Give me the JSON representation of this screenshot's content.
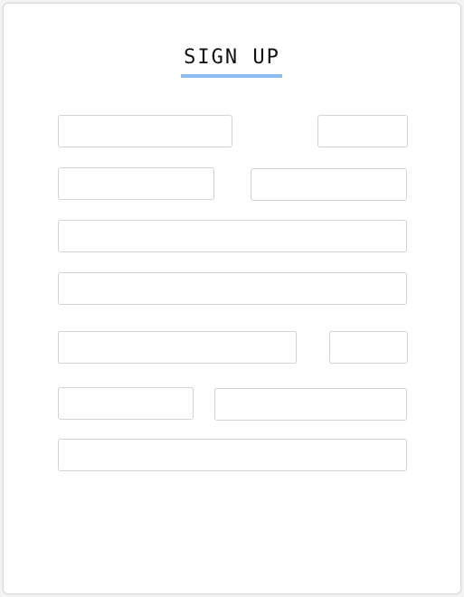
{
  "form": {
    "title": "SIGN UP",
    "fields": [
      {
        "value": "",
        "placeholder": ""
      },
      {
        "value": "",
        "placeholder": ""
      },
      {
        "value": "",
        "placeholder": ""
      },
      {
        "value": "",
        "placeholder": ""
      },
      {
        "value": "",
        "placeholder": ""
      },
      {
        "value": "",
        "placeholder": ""
      },
      {
        "value": "",
        "placeholder": ""
      },
      {
        "value": "",
        "placeholder": ""
      },
      {
        "value": "",
        "placeholder": ""
      },
      {
        "value": "",
        "placeholder": ""
      },
      {
        "value": "",
        "placeholder": ""
      }
    ]
  },
  "colors": {
    "accent_underline": "#8fbcf3",
    "field_border": "#d3d3d3",
    "background": "#f3f3f3",
    "card": "#ffffff"
  }
}
